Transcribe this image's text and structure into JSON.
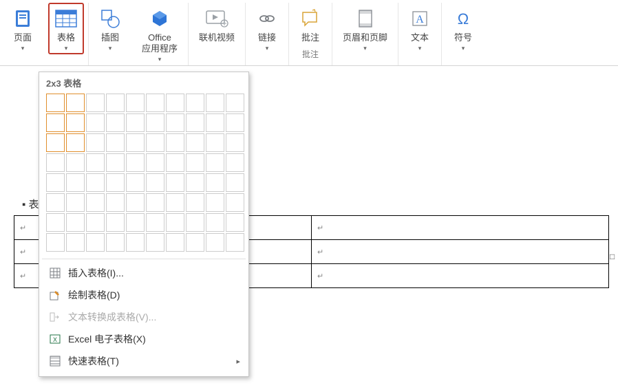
{
  "ribbon": {
    "page": "页面",
    "table": "表格",
    "illustration": "插图",
    "office_apps": "Office\n应用程序",
    "online_video": "联机视频",
    "link": "链接",
    "comment": "批注",
    "comment_group": "批注",
    "header_footer": "页眉和页脚",
    "text": "文本",
    "symbol": "符号"
  },
  "table_menu": {
    "title": "2x3 表格",
    "selection": {
      "cols": 2,
      "rows": 3
    },
    "grid": {
      "cols": 10,
      "rows": 8
    },
    "items": {
      "insert_table": "插入表格(I)...",
      "draw_table": "绘制表格(D)",
      "convert_text": "文本转换成表格(V)...",
      "excel_spreadsheet": "Excel 电子表格(X)",
      "quick_tables": "快速表格(T)"
    }
  },
  "document": {
    "heading_prefix": "▪",
    "heading": "表",
    "para_mark": "↵"
  },
  "icons": {
    "dropdown": "▾",
    "submenu": "▸"
  }
}
